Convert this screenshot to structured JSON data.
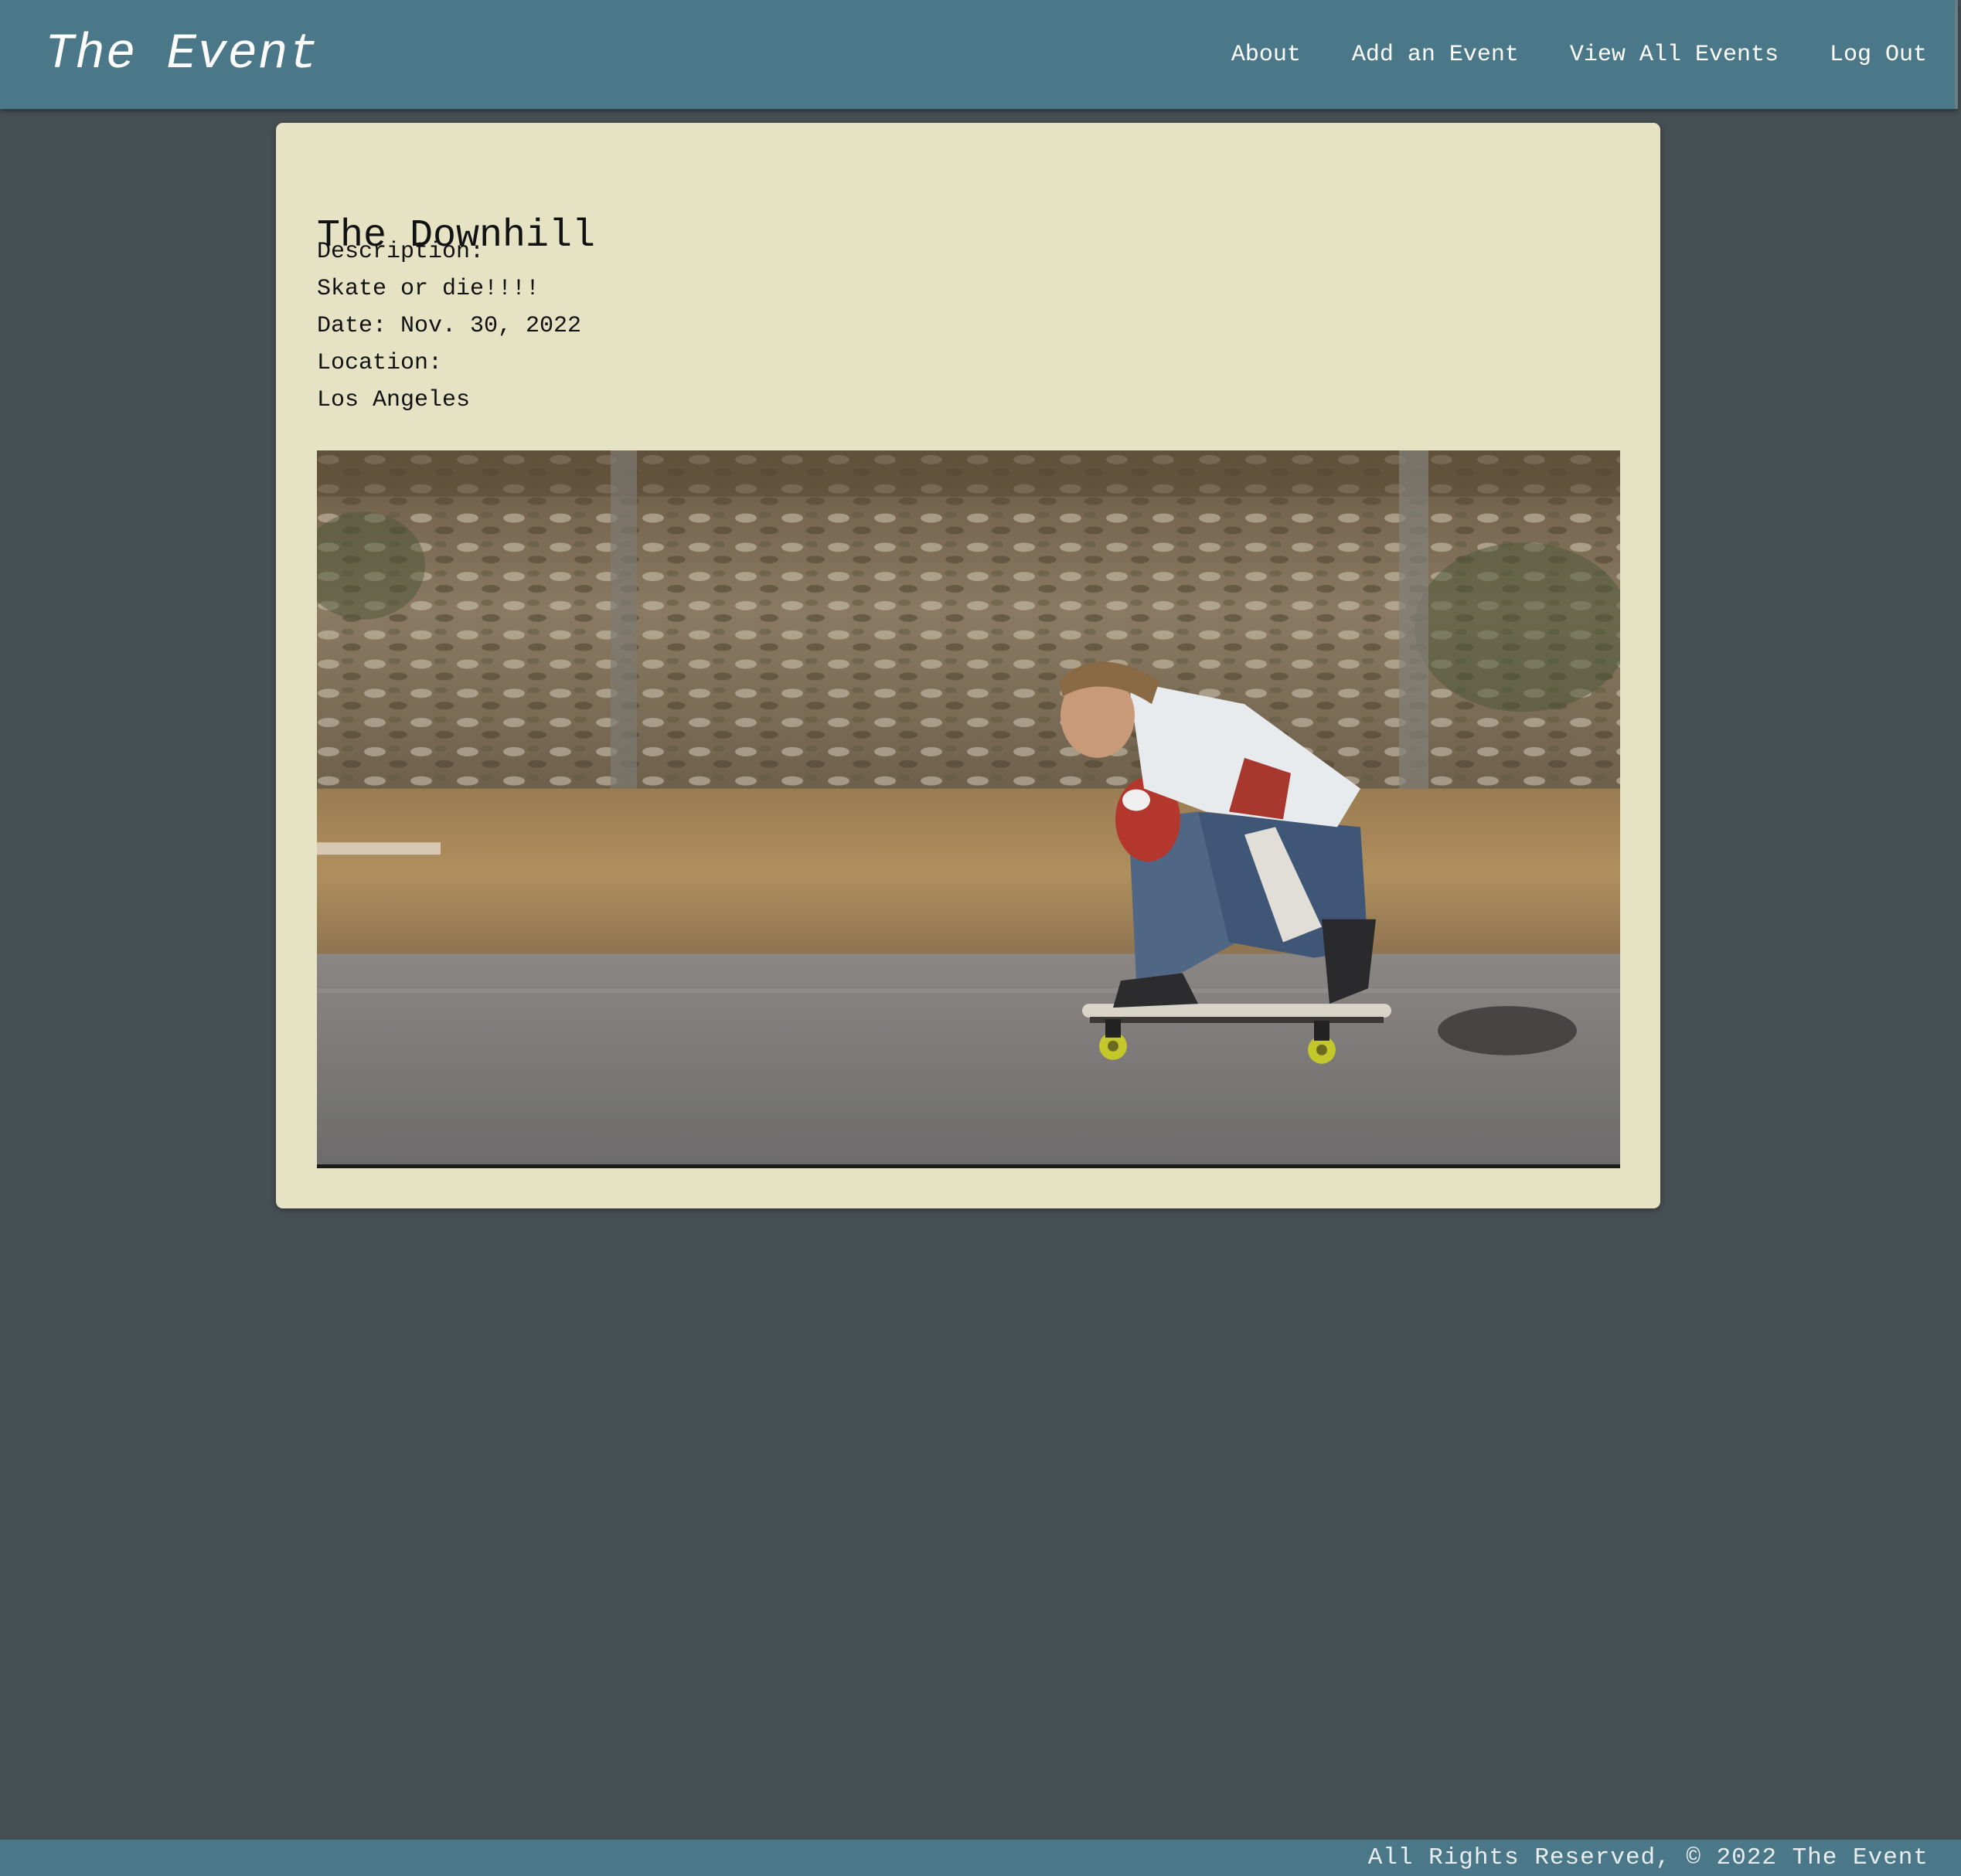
{
  "nav": {
    "brand": "The Event",
    "links": [
      "About",
      "Add an Event",
      "View All Events",
      "Log Out"
    ]
  },
  "event": {
    "title": "The Downhill",
    "description_label": "Description:",
    "description": "Skate or die!!!!",
    "date": "Date: Nov. 30, 2022",
    "location_label": "Location:",
    "location": "Los Angeles",
    "image_subject": "skateboarder crouching on a longboard speeding down a road past a dry hillside"
  },
  "footer": {
    "text": "All Rights Reserved, © 2022 The Event"
  },
  "colors": {
    "navbar": "#4b7889",
    "background": "#464f53",
    "card": "#e6e3c4"
  }
}
